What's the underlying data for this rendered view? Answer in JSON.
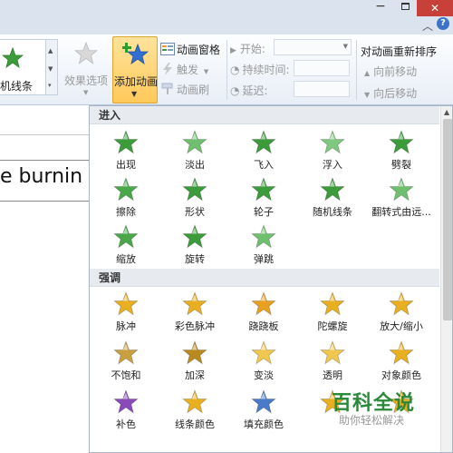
{
  "window": {
    "minimize": "−",
    "close": "✕",
    "collapse_ribbon": "︿",
    "help": "?"
  },
  "ribbon": {
    "gallery_label": "机线条",
    "effect_options": "效果选项",
    "add_animation": "添加动画",
    "animation_pane": "动画窗格",
    "trigger": "触发",
    "animation_painter": "动画刷",
    "timing": {
      "start_label": "开始:",
      "duration_label": "持续时间:",
      "delay_label": "延迟:"
    },
    "reorder": {
      "title": "对动画重新排序",
      "move_earlier": "向前移动",
      "move_later": "向后移动"
    }
  },
  "slide": {
    "text": "e burnin"
  },
  "dropdown": {
    "sections": [
      {
        "title": "进入",
        "items": [
          {
            "label": "出现",
            "icon": "star-appear-icon",
            "color": "#3c9c3c"
          },
          {
            "label": "淡出",
            "icon": "star-fade-icon",
            "color": "#6fbf6f"
          },
          {
            "label": "飞入",
            "icon": "star-fly-in-icon",
            "color": "#3c9c3c"
          },
          {
            "label": "浮入",
            "icon": "star-float-in-icon",
            "color": "#7fc87f"
          },
          {
            "label": "劈裂",
            "icon": "star-split-icon",
            "color": "#3c9c3c"
          },
          {
            "label": "擦除",
            "icon": "star-wipe-icon",
            "color": "#4aa84a"
          },
          {
            "label": "形状",
            "icon": "star-shape-icon",
            "color": "#3c9c3c"
          },
          {
            "label": "轮子",
            "icon": "star-wheel-icon",
            "color": "#3c9c3c"
          },
          {
            "label": "随机线条",
            "icon": "star-random-bars-icon",
            "color": "#3c9c3c"
          },
          {
            "label": "翻转式由远...",
            "icon": "star-grow-turn-icon",
            "color": "#6fbf6f"
          },
          {
            "label": "缩放",
            "icon": "star-zoom-icon",
            "color": "#4aa84a"
          },
          {
            "label": "旋转",
            "icon": "star-swivel-icon",
            "color": "#3c9c3c"
          },
          {
            "label": "弹跳",
            "icon": "star-bounce-icon",
            "color": "#6fbf6f"
          }
        ]
      },
      {
        "title": "强调",
        "items": [
          {
            "label": "脉冲",
            "icon": "star-pulse-icon",
            "color": "#e8b020"
          },
          {
            "label": "彩色脉冲",
            "icon": "star-color-pulse-icon",
            "color": "#e8b020"
          },
          {
            "label": "跷跷板",
            "icon": "star-teeter-icon",
            "color": "#e8a020"
          },
          {
            "label": "陀螺旋",
            "icon": "star-spin-icon",
            "color": "#e8b020"
          },
          {
            "label": "放大/缩小",
            "icon": "star-grow-shrink-icon",
            "color": "#e8b020"
          },
          {
            "label": "不饱和",
            "icon": "star-desaturate-icon",
            "color": "#c9a040"
          },
          {
            "label": "加深",
            "icon": "star-darken-icon",
            "color": "#b88a20"
          },
          {
            "label": "变淡",
            "icon": "star-lighten-icon",
            "color": "#f0c850"
          },
          {
            "label": "透明",
            "icon": "star-transparency-icon",
            "color": "#f0c850"
          },
          {
            "label": "对象颜色",
            "icon": "star-object-color-icon",
            "color": "#e8b020"
          },
          {
            "label": "补色",
            "icon": "star-complementary-icon",
            "color": "#8a4ab8"
          },
          {
            "label": "线条颜色",
            "icon": "star-line-color-icon",
            "color": "#e8b020"
          },
          {
            "label": "填充颜色",
            "icon": "star-fill-color-icon",
            "color": "#4a7ac8"
          },
          {
            "label": "",
            "icon": "star-brush-color-icon",
            "color": "#e8b020"
          },
          {
            "label": "",
            "icon": "star-underline-icon",
            "color": "#e8b020"
          }
        ]
      }
    ]
  },
  "watermark": {
    "title": "百科全说",
    "subtitle": "助你轻松解决"
  }
}
